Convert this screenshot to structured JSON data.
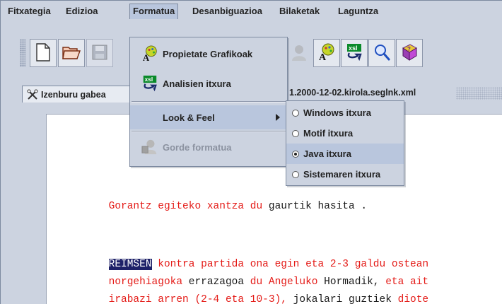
{
  "menubar": {
    "items": [
      {
        "label": "Fitxategia"
      },
      {
        "label": "Edizioa"
      },
      {
        "label": "Formatua"
      },
      {
        "label": "Desanbiguazioa"
      },
      {
        "label": "Bilaketak"
      },
      {
        "label": "Laguntza"
      }
    ]
  },
  "toolbar": {
    "buttons": [
      {
        "icon": "new-document-icon"
      },
      {
        "icon": "open-folder-icon"
      },
      {
        "icon": "save-disk-icon"
      },
      {
        "icon": "person-icon"
      },
      {
        "icon": "graphic-properties-icon"
      },
      {
        "icon": "xsl-icon"
      },
      {
        "icon": "magnifier-icon"
      },
      {
        "icon": "help-book-icon"
      }
    ]
  },
  "tabs": {
    "active_label": "Izenburu gabea",
    "second_label": "1.2000-12-02.kirola.seglnk.xml"
  },
  "formatua_menu": {
    "items": [
      {
        "label": "Propietate Grafikoak",
        "icon": "graphic-properties-icon"
      },
      {
        "label": "Analisien itxura",
        "icon": "xsl-icon"
      },
      {
        "label": "Look & Feel",
        "has_submenu": true
      },
      {
        "label": "Gorde formatua",
        "icon": "save-format-icon",
        "disabled": true
      }
    ]
  },
  "lookfeel_menu": {
    "items": [
      {
        "label": "Windows itxura",
        "checked": false
      },
      {
        "label": "Motif itxura",
        "checked": false
      },
      {
        "label": "Java itxura",
        "checked": true
      },
      {
        "label": "Sistemaren itxura",
        "checked": false
      }
    ]
  },
  "document": {
    "lines": [
      {
        "segments": [
          {
            "text": "Gorantz egiteko xantza du ",
            "style": "red"
          },
          {
            "text": "gaurtik hasita .",
            "style": "black"
          }
        ]
      },
      {
        "segments": [
          {
            "text": "REIMSEN",
            "style": "highlight"
          },
          {
            "text": " kontra partida ona egin eta 2-3 galdu ostean",
            "style": "red"
          }
        ]
      },
      {
        "segments": [
          {
            "text": "norgehiagoka",
            "style": "red"
          },
          {
            "text": " errazagoa ",
            "style": "black"
          },
          {
            "text": "du Angeluko",
            "style": "red"
          },
          {
            "text": " Hormadik, ",
            "style": "black"
          },
          {
            "text": "eta ait",
            "style": "red"
          }
        ]
      },
      {
        "segments": [
          {
            "text": "irabazi arren (2-4 eta 10-3), ",
            "style": "red"
          },
          {
            "text": "jokalari",
            "style": "black"
          },
          {
            "text": " guztiek ",
            "style": "black"
          },
          {
            "text": "diote",
            "style": "red"
          }
        ]
      }
    ]
  },
  "colors": {
    "chrome": "#ccd3e0",
    "selection": "#b9c6dd",
    "text_red": "#e41b17",
    "highlight_bg": "#1e2168"
  }
}
